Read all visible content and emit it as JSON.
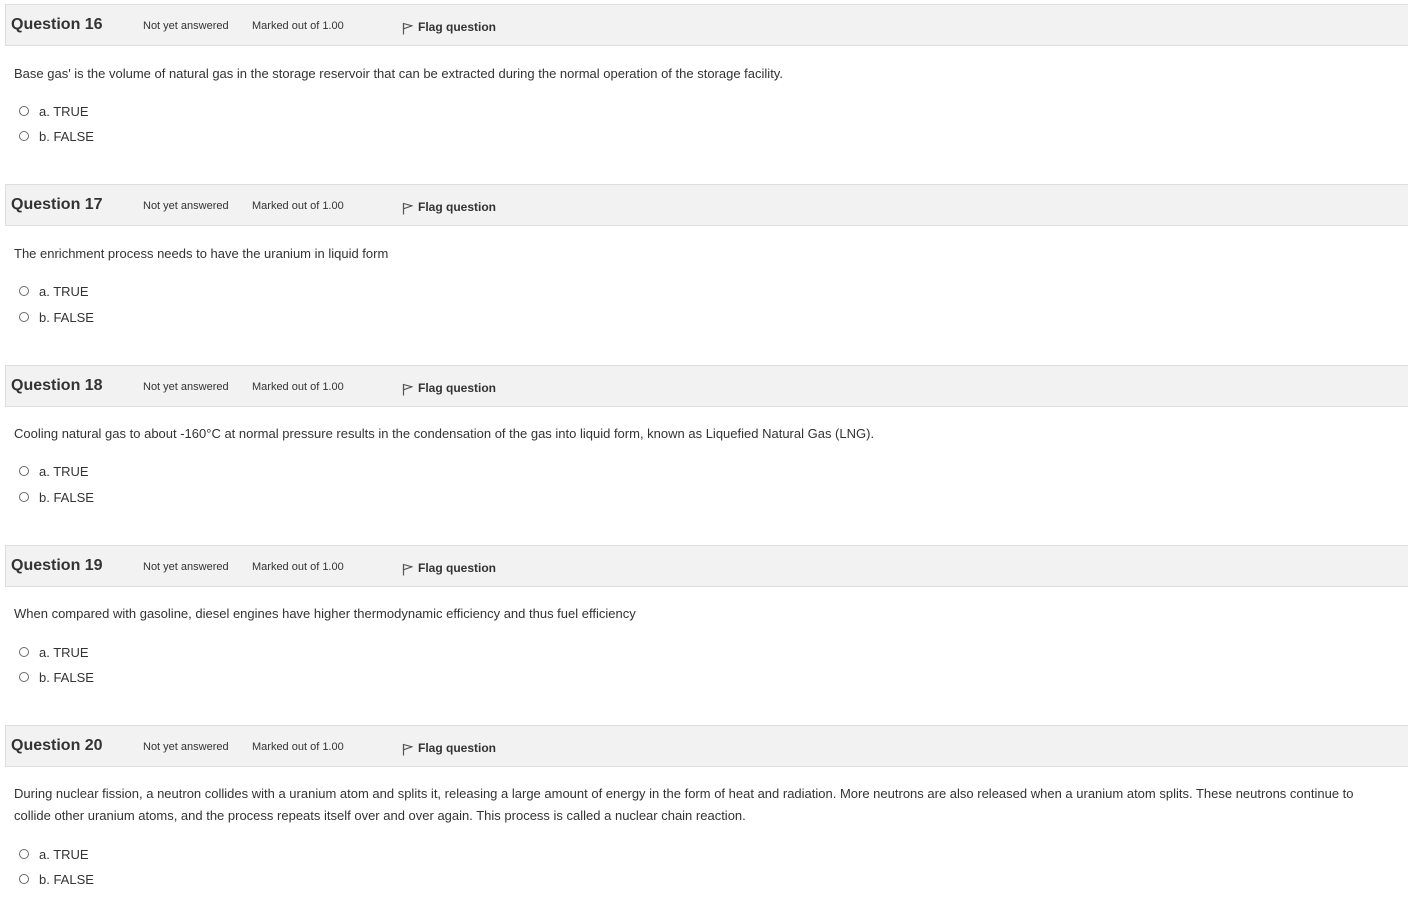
{
  "questions": [
    {
      "title": "Question 16",
      "state": "Not yet answered",
      "grade": "Marked out of 1.00",
      "flag_label": "Flag question",
      "text": "Base gas' is the volume of natural gas in the storage reservoir that can be extracted during the normal operation of the storage facility.",
      "answers": [
        "a. TRUE",
        "b. FALSE"
      ]
    },
    {
      "title": "Question 17",
      "state": "Not yet answered",
      "grade": "Marked out of 1.00",
      "flag_label": "Flag question",
      "text": "The enrichment process needs to have the uranium in liquid form",
      "answers": [
        "a. TRUE",
        "b. FALSE"
      ]
    },
    {
      "title": "Question 18",
      "state": "Not yet answered",
      "grade": "Marked out of 1.00",
      "flag_label": "Flag question",
      "text": "Cooling natural gas to about -160°C at normal pressure results in the condensation of the gas into liquid form, known as Liquefied Natural Gas (LNG).",
      "answers": [
        "a. TRUE",
        "b. FALSE"
      ]
    },
    {
      "title": "Question 19",
      "state": "Not yet answered",
      "grade": "Marked out of 1.00",
      "flag_label": "Flag question",
      "text": "When compared with gasoline, diesel engines have higher thermodynamic efficiency and thus fuel efficiency",
      "answers": [
        "a. TRUE",
        "b. FALSE"
      ]
    },
    {
      "title": "Question 20",
      "state": "Not yet answered",
      "grade": "Marked out of 1.00",
      "flag_label": "Flag question",
      "text": "During nuclear fission, a neutron collides with a uranium atom and splits it, releasing a large amount of energy in the form of heat and radiation. More neutrons are also released when a uranium atom splits. These neutrons continue to collide other uranium atoms, and the process repeats itself over and over again. This process is called a nuclear chain reaction.",
      "answers": [
        "a. TRUE",
        "b. FALSE"
      ]
    }
  ],
  "icons": {
    "flag": "flag-icon",
    "radio": "radio-button"
  }
}
